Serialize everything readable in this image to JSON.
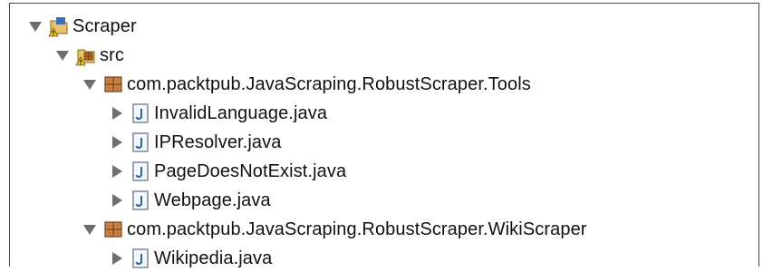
{
  "tree": {
    "project": {
      "label": "Scraper",
      "icon": "project-folder-warning-icon",
      "expanded": true
    },
    "src": {
      "label": "src",
      "icon": "source-folder-warning-icon",
      "expanded": true
    },
    "packages": [
      {
        "label": "com.packtpub.JavaScraping.RobustScraper.Tools",
        "icon": "package-icon",
        "expanded": true,
        "files": [
          {
            "label": "InvalidLanguage.java",
            "icon": "java-file-icon"
          },
          {
            "label": "IPResolver.java",
            "icon": "java-file-icon"
          },
          {
            "label": "PageDoesNotExist.java",
            "icon": "java-file-icon"
          },
          {
            "label": "Webpage.java",
            "icon": "java-file-icon"
          }
        ]
      },
      {
        "label": "com.packtpub.JavaScraping.RobustScraper.WikiScraper",
        "icon": "package-icon",
        "expanded": true,
        "files": [
          {
            "label": "Wikipedia.java",
            "icon": "java-file-icon"
          }
        ]
      }
    ]
  },
  "colors": {
    "border": "#4a4a4a",
    "triangle": "#6e6e6e",
    "package_brown": "#9a5a2a",
    "java_blue": "#2b5fa6"
  }
}
